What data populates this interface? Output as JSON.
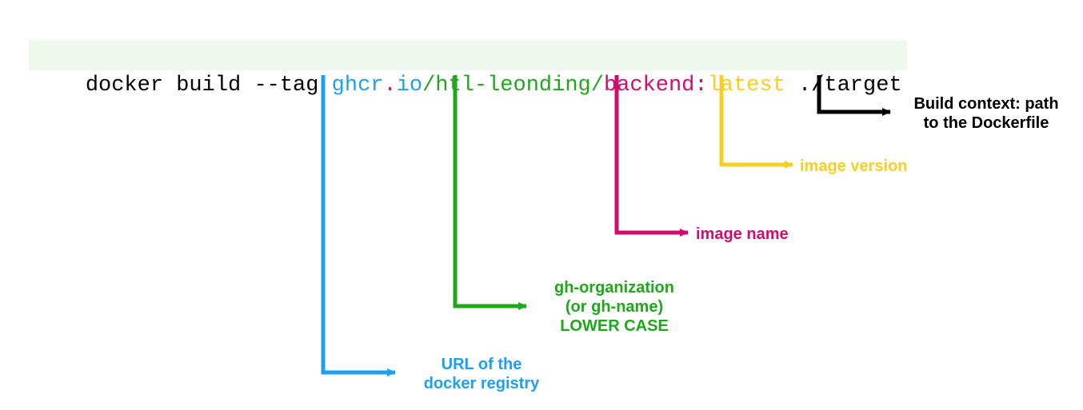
{
  "command": {
    "prefix": "docker build --tag ",
    "registry_url": "ghcr",
    "dot": ".",
    "registry_tld": "io",
    "slash1": "/",
    "organization": "htl-leonding",
    "slash2": "/",
    "image_name": "backend",
    "colon": ":",
    "image_version": "latest",
    "suffix": " ./target"
  },
  "annotations": {
    "registry": {
      "line1": "URL of the",
      "line2": "docker registry",
      "color": "#1ea0f0"
    },
    "organization": {
      "line1": "gh-organization",
      "line2": "(or gh-name)",
      "line3": "LOWER CASE",
      "color": "#1ea81a"
    },
    "image_name": {
      "line1": "image name",
      "color": "#cf0d6e"
    },
    "image_version": {
      "line1": "image version",
      "color": "#f7cf24"
    },
    "build_context": {
      "line1": "Build context: path",
      "line2": "to the Dockerfile",
      "color": "#000000"
    }
  }
}
